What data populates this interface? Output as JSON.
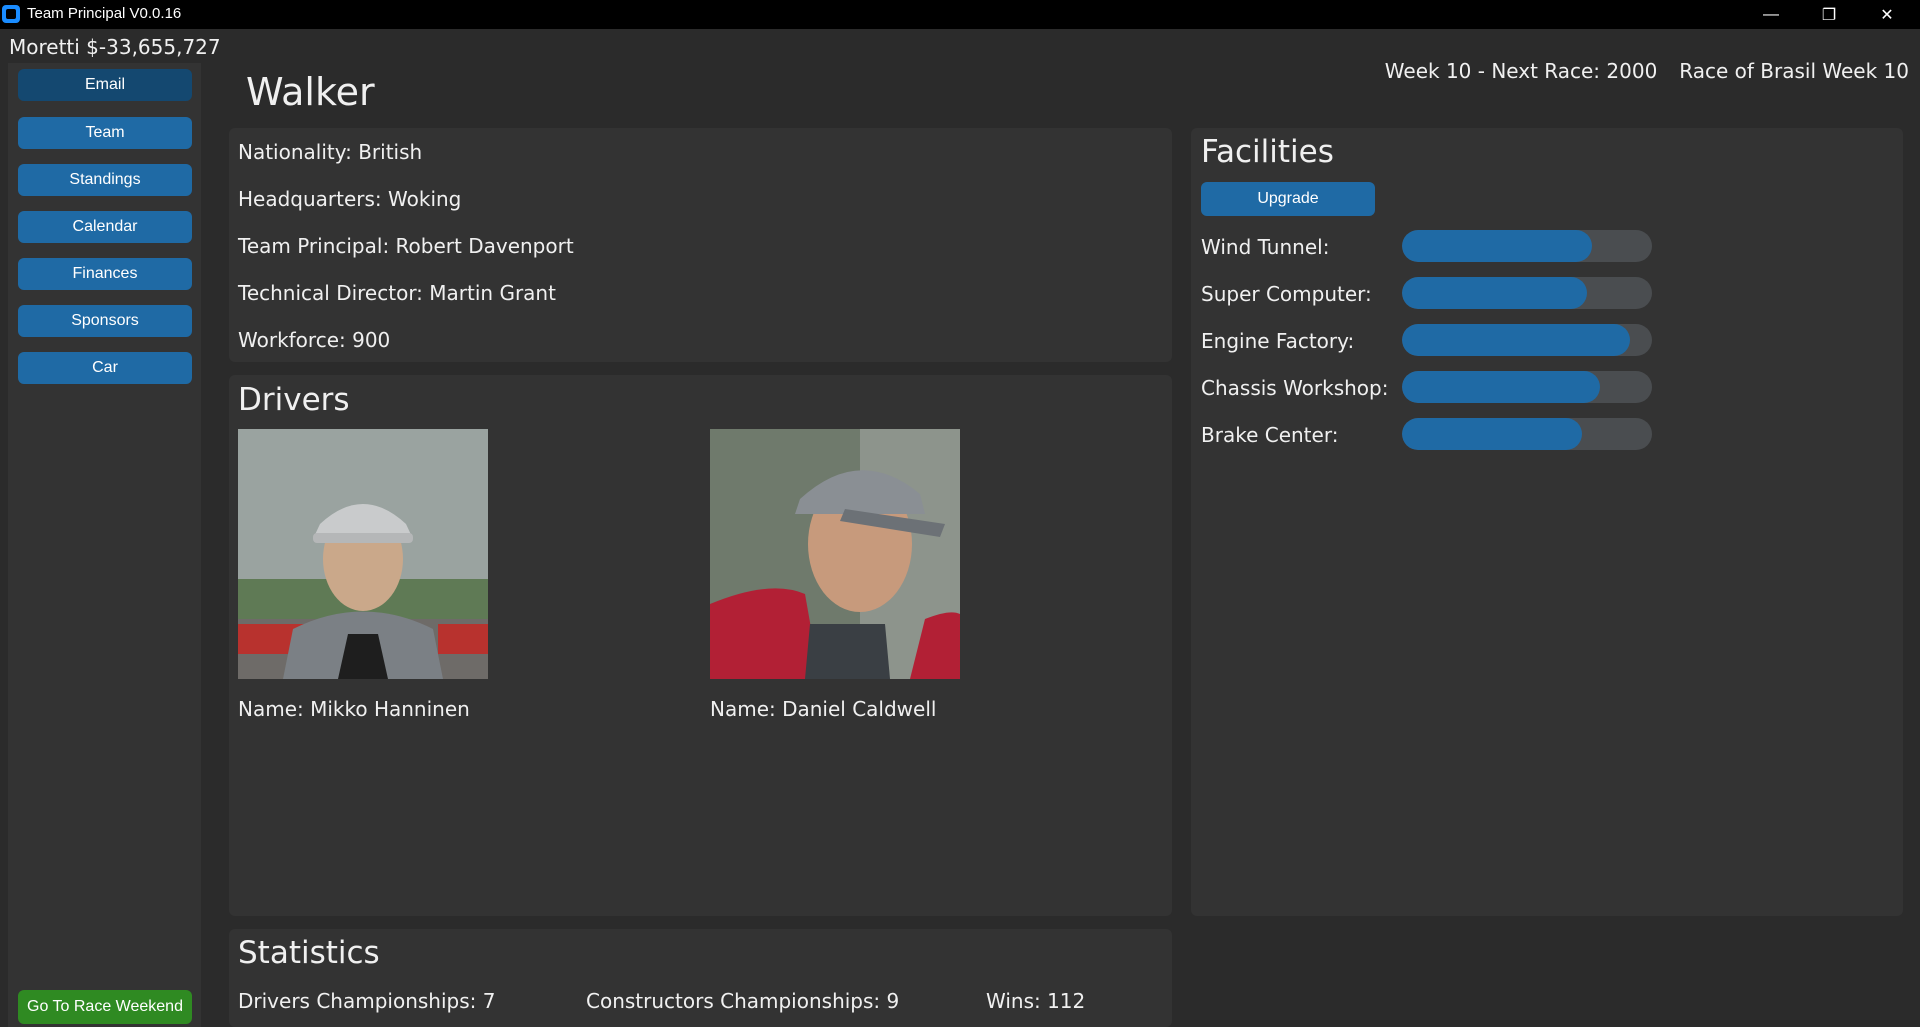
{
  "window": {
    "title": "Team Principal V0.0.16",
    "minimize_glyph": "—",
    "restore_glyph": "❐",
    "close_glyph": "✕"
  },
  "topbar": {
    "player_money": "Moretti $-33,655,727",
    "week_info": "Week 10 - Next Race: 2000",
    "race_info": "Race of Brasil Week 10"
  },
  "sidebar": {
    "items": [
      {
        "label": "Email"
      },
      {
        "label": "Team"
      },
      {
        "label": "Standings"
      },
      {
        "label": "Calendar"
      },
      {
        "label": "Finances"
      },
      {
        "label": "Sponsors"
      },
      {
        "label": "Car"
      }
    ],
    "race_button": "Go To Race Weekend"
  },
  "team": {
    "name": "Walker",
    "info": [
      "Nationality: British",
      "Headquarters: Woking",
      "Team Principal: Robert Davenport",
      "Technical Director: Martin Grant",
      "Workforce: 900"
    ]
  },
  "drivers": {
    "title": "Drivers",
    "list": [
      {
        "name": "Name: Mikko Hanninen"
      },
      {
        "name": "Name: Daniel Caldwell"
      }
    ]
  },
  "facilities": {
    "title": "Facilities",
    "upgrade_label": "Upgrade",
    "items": [
      {
        "label": "Wind Tunnel:",
        "level": 0.76
      },
      {
        "label": "Super Computer:",
        "level": 0.74
      },
      {
        "label": "Engine Factory:",
        "level": 0.91
      },
      {
        "label": "Chassis Workshop:",
        "level": 0.79
      },
      {
        "label": "Brake Center:",
        "level": 0.72
      }
    ],
    "bar_color": "#1f6aa5"
  },
  "statistics": {
    "title": "Statistics",
    "drivers_championships": "Drivers Championships: 7",
    "constructors_championships": "Constructors Championships: 9",
    "wins": "Wins: 112"
  }
}
